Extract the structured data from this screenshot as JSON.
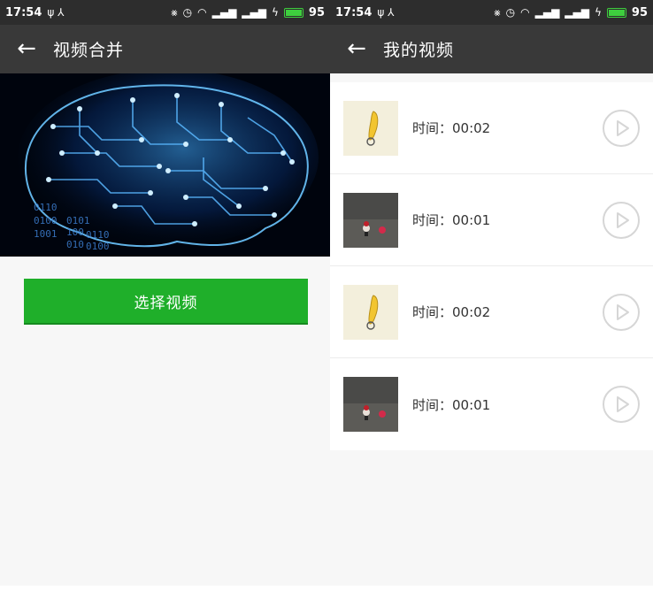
{
  "status_bar": {
    "time": "17:54",
    "left_icons": "ψ ⅄",
    "battery_level": "95"
  },
  "merge_screen": {
    "title": "视频合并",
    "hero_digits": [
      "0110",
      "0100",
      "1001",
      "0101",
      "100",
      "0110",
      "010",
      "0100"
    ],
    "select_button_label": "选择视频",
    "accent_color": "#1faf2a"
  },
  "videos_screen": {
    "title": "我的视频",
    "items": [
      {
        "thumbnail": "banana-thumbnail",
        "time_text": "时间：00:02"
      },
      {
        "thumbnail": "toy-thumbnail",
        "time_text": "时间：00:01"
      },
      {
        "thumbnail": "banana-thumbnail",
        "time_text": "时间：00:02"
      },
      {
        "thumbnail": "toy-thumbnail",
        "time_text": "时间：00:01"
      }
    ]
  },
  "icons": [
    "back-arrow-icon",
    "play-icon",
    "wifi-icon",
    "alarm-icon",
    "signal-icon",
    "battery-icon"
  ]
}
